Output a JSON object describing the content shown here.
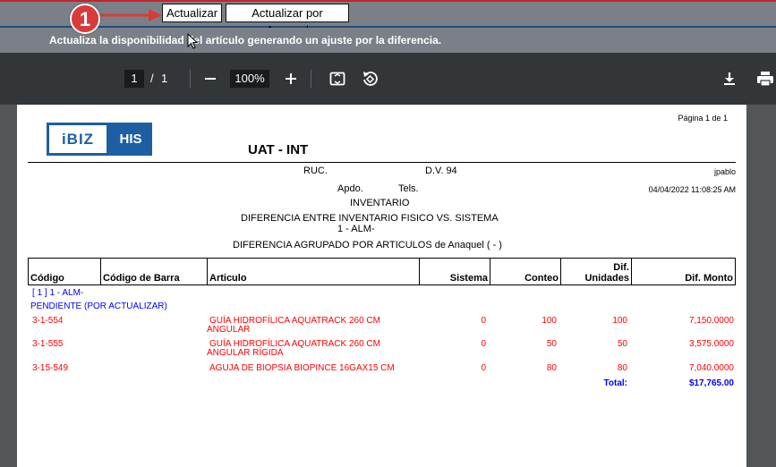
{
  "toolbar": {
    "annotation_number": "1",
    "actualizar_label": "Actualizar",
    "actualizar_anaquel_label": "Actualizar por Anaquel",
    "description": "Actualiza la disponibilidad del artículo generando un ajuste por la diferencia."
  },
  "viewer": {
    "current_page": "1",
    "separator": "/",
    "total_pages": "1",
    "zoom": "100%"
  },
  "report": {
    "page_label": "Página 1 de 1",
    "logo_left": "iBIZ",
    "logo_right": "HIS",
    "company": "UAT - INT",
    "ruc": "RUC.",
    "dv": "D.V. 94",
    "user": "jpablo",
    "apdo": "Apdo.",
    "tels": "Tels.",
    "datetime": "04/04/2022 11:08:25 AM",
    "title1": "INVENTARIO",
    "title2": "DIFERENCIA ENTRE INVENTARIO FISICO VS. SISTEMA",
    "title3": "1 - ALM-",
    "title4": "DIFERENCIA AGRUPADO POR ARTICULOS de Anaquel ( - )",
    "columns": [
      "Código",
      "Código de Barra",
      "Articulo",
      "Sistema",
      "Conteo",
      "Dif. Unidades",
      "Dif. Monto"
    ],
    "col_dif_line1": "Dif.",
    "col_dif_line2": "Unidades",
    "group_label": "[ 1 ] 1 - ALM-",
    "status_label": "PENDIENTE (POR ACTUALIZAR)",
    "rows": [
      {
        "codigo": "3-1-554",
        "articulo1": "GUÍA HIDROFÍLICA AQUATRACK 260 CM",
        "articulo2": "ANGULAR",
        "sistema": "0",
        "conteo": "100",
        "dif_unidades": "100",
        "dif_monto": "7,150.0000"
      },
      {
        "codigo": "3-1-555",
        "articulo1": "GUÍA HIDROFÍLICA AQUATRACK 260 CM",
        "articulo2": "ANGULAR RÍGIDA",
        "sistema": "0",
        "conteo": "50",
        "dif_unidades": "50",
        "dif_monto": "3,575.0000"
      },
      {
        "codigo": "3-15-549",
        "articulo1": "AGUJA DE BIOPSIA BIOPINCE 16GAX15 CM",
        "articulo2": "",
        "sistema": "0",
        "conteo": "80",
        "dif_unidades": "80",
        "dif_monto": "7,040.0000"
      }
    ],
    "total_label": "Total:",
    "total_value": "$17,765.00"
  },
  "colors": {
    "accent_red": "#d93a3a",
    "toolbar_gray": "#7b8088",
    "viewer_dark": "#323639",
    "blue_text": "#0000ff",
    "red_text": "#ff0000"
  }
}
